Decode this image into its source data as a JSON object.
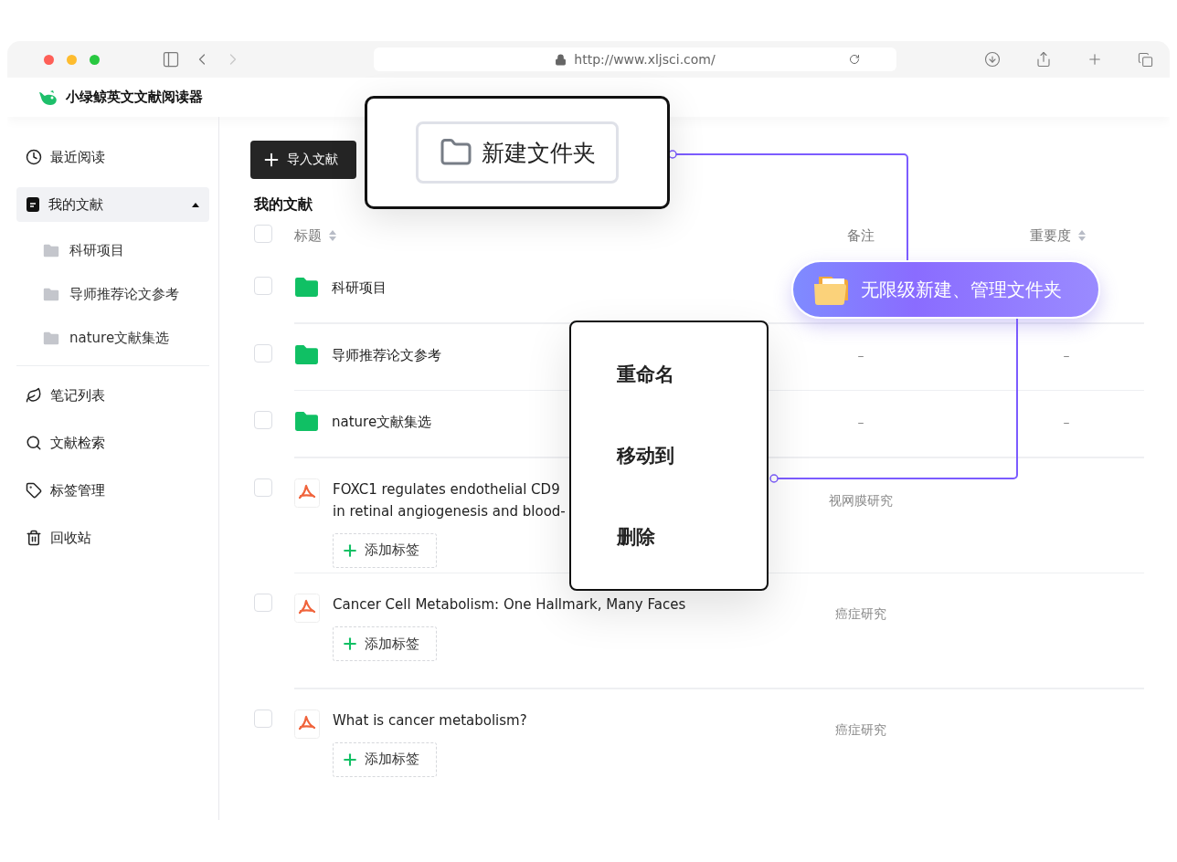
{
  "browser": {
    "url": "http://www.xljsci.com/"
  },
  "app": {
    "title": "小绿鲸英文文献阅读器"
  },
  "sidebar": {
    "items": [
      {
        "kind": "recent",
        "label": "最近阅读",
        "selected": false
      },
      {
        "kind": "library",
        "label": "我的文献",
        "selected": true,
        "expanded": true,
        "children": [
          {
            "label": "科研项目"
          },
          {
            "label": "导师推荐论文参考"
          },
          {
            "label": "nature文献集选"
          }
        ]
      },
      {
        "kind": "notes",
        "label": "笔记列表",
        "selected": false
      },
      {
        "kind": "search",
        "label": "文献检索",
        "selected": false
      },
      {
        "kind": "tags",
        "label": "标签管理",
        "selected": false
      },
      {
        "kind": "trash",
        "label": "回收站",
        "selected": false
      }
    ]
  },
  "toolbar": {
    "import_button": "导入文献"
  },
  "section_title": "我的文献",
  "table": {
    "header_checked": false,
    "columns": [
      {
        "label": "标题",
        "sortable": true
      },
      {
        "label": "备注"
      },
      {
        "label": "重要度",
        "sortable": true
      }
    ],
    "rows": [
      {
        "kind": "folder",
        "checked": false,
        "title_lines": [
          "科研项目"
        ]
      },
      {
        "kind": "folder",
        "checked": false,
        "title_lines": [
          "导师推荐论文参考"
        ],
        "note": "–",
        "importance": "–"
      },
      {
        "kind": "folder",
        "checked": false,
        "title_lines": [
          "nature文献集选"
        ],
        "note": "–",
        "importance": "–"
      },
      {
        "kind": "document",
        "checked": false,
        "title_lines": [
          "FOXC1 regulates endothelial CD9",
          "in retinal angiogenesis and blood-"
        ],
        "note": "视网膜研究",
        "tag_button": "添加标签"
      },
      {
        "kind": "document",
        "checked": false,
        "title_lines": [
          "Cancer Cell Metabolism: One Hallmark, Many Faces"
        ],
        "note": "癌症研究",
        "tag_button": "添加标签"
      },
      {
        "kind": "document",
        "checked": false,
        "title_lines": [
          "What is cancer metabolism?"
        ],
        "note": "癌症研究",
        "tag_button": "添加标签"
      }
    ]
  },
  "callout": {
    "label": "新建文件夹"
  },
  "feature_pill": {
    "label": "无限级新建、管理文件夹"
  },
  "context_menu": {
    "items": [
      "重命名",
      "移动到",
      "删除"
    ]
  }
}
